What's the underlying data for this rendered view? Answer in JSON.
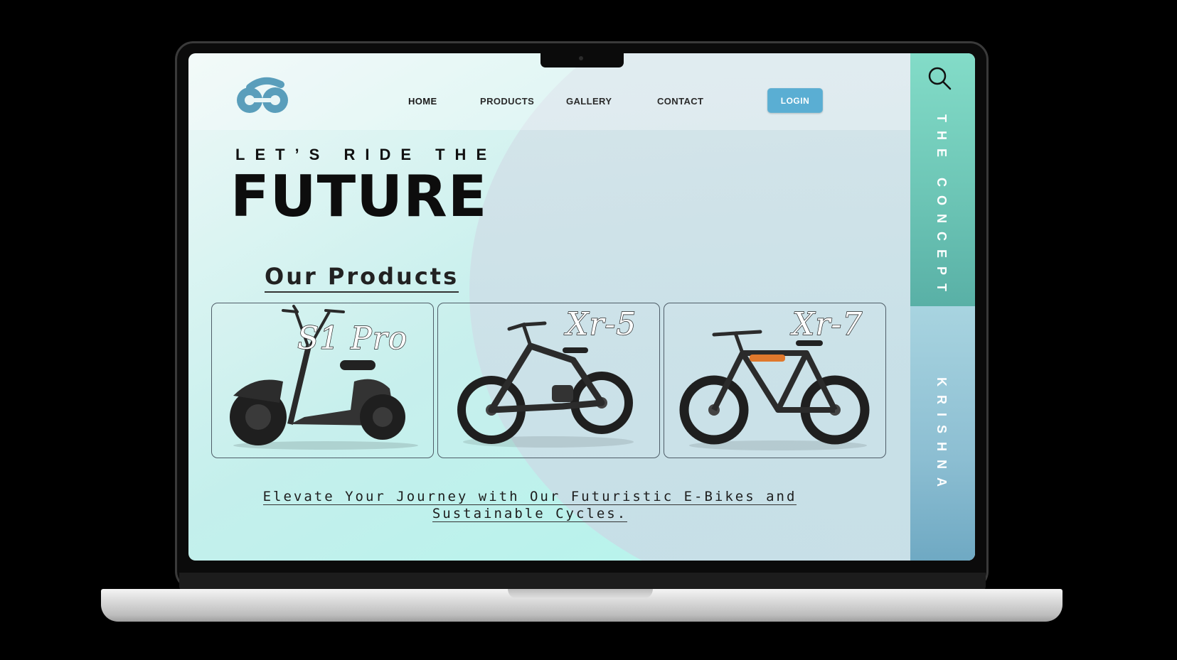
{
  "nav": {
    "home": "HOME",
    "products": "PRODUCTS",
    "gallery": "GALLERY",
    "contact": "CONTACT",
    "login": "LOGIN"
  },
  "hero": {
    "tagline": "LET’S RIDE THE",
    "title": "FUTURE"
  },
  "products": {
    "heading": "Our Products",
    "items": [
      {
        "name": "S1 Pro",
        "kind": "e-scooter"
      },
      {
        "name": "Xr-5",
        "kind": "fat-tire e-bike"
      },
      {
        "name": "Xr-7",
        "kind": "fat-tire e-bike"
      }
    ]
  },
  "blurb": {
    "line1": "Elevate Your Journey with Our Futuristic E-Bikes and",
    "line2": "Sustainable Cycles."
  },
  "side_panel": {
    "top_text": "THE CONCEPT",
    "bottom_text": "KRISHNA"
  },
  "icons": {
    "search": "search-icon",
    "logo": "bike-logo-icon"
  },
  "colors": {
    "accent": "#5aaed3",
    "side_top": "#6dc6b6",
    "side_bottom": "#8cbed2"
  }
}
